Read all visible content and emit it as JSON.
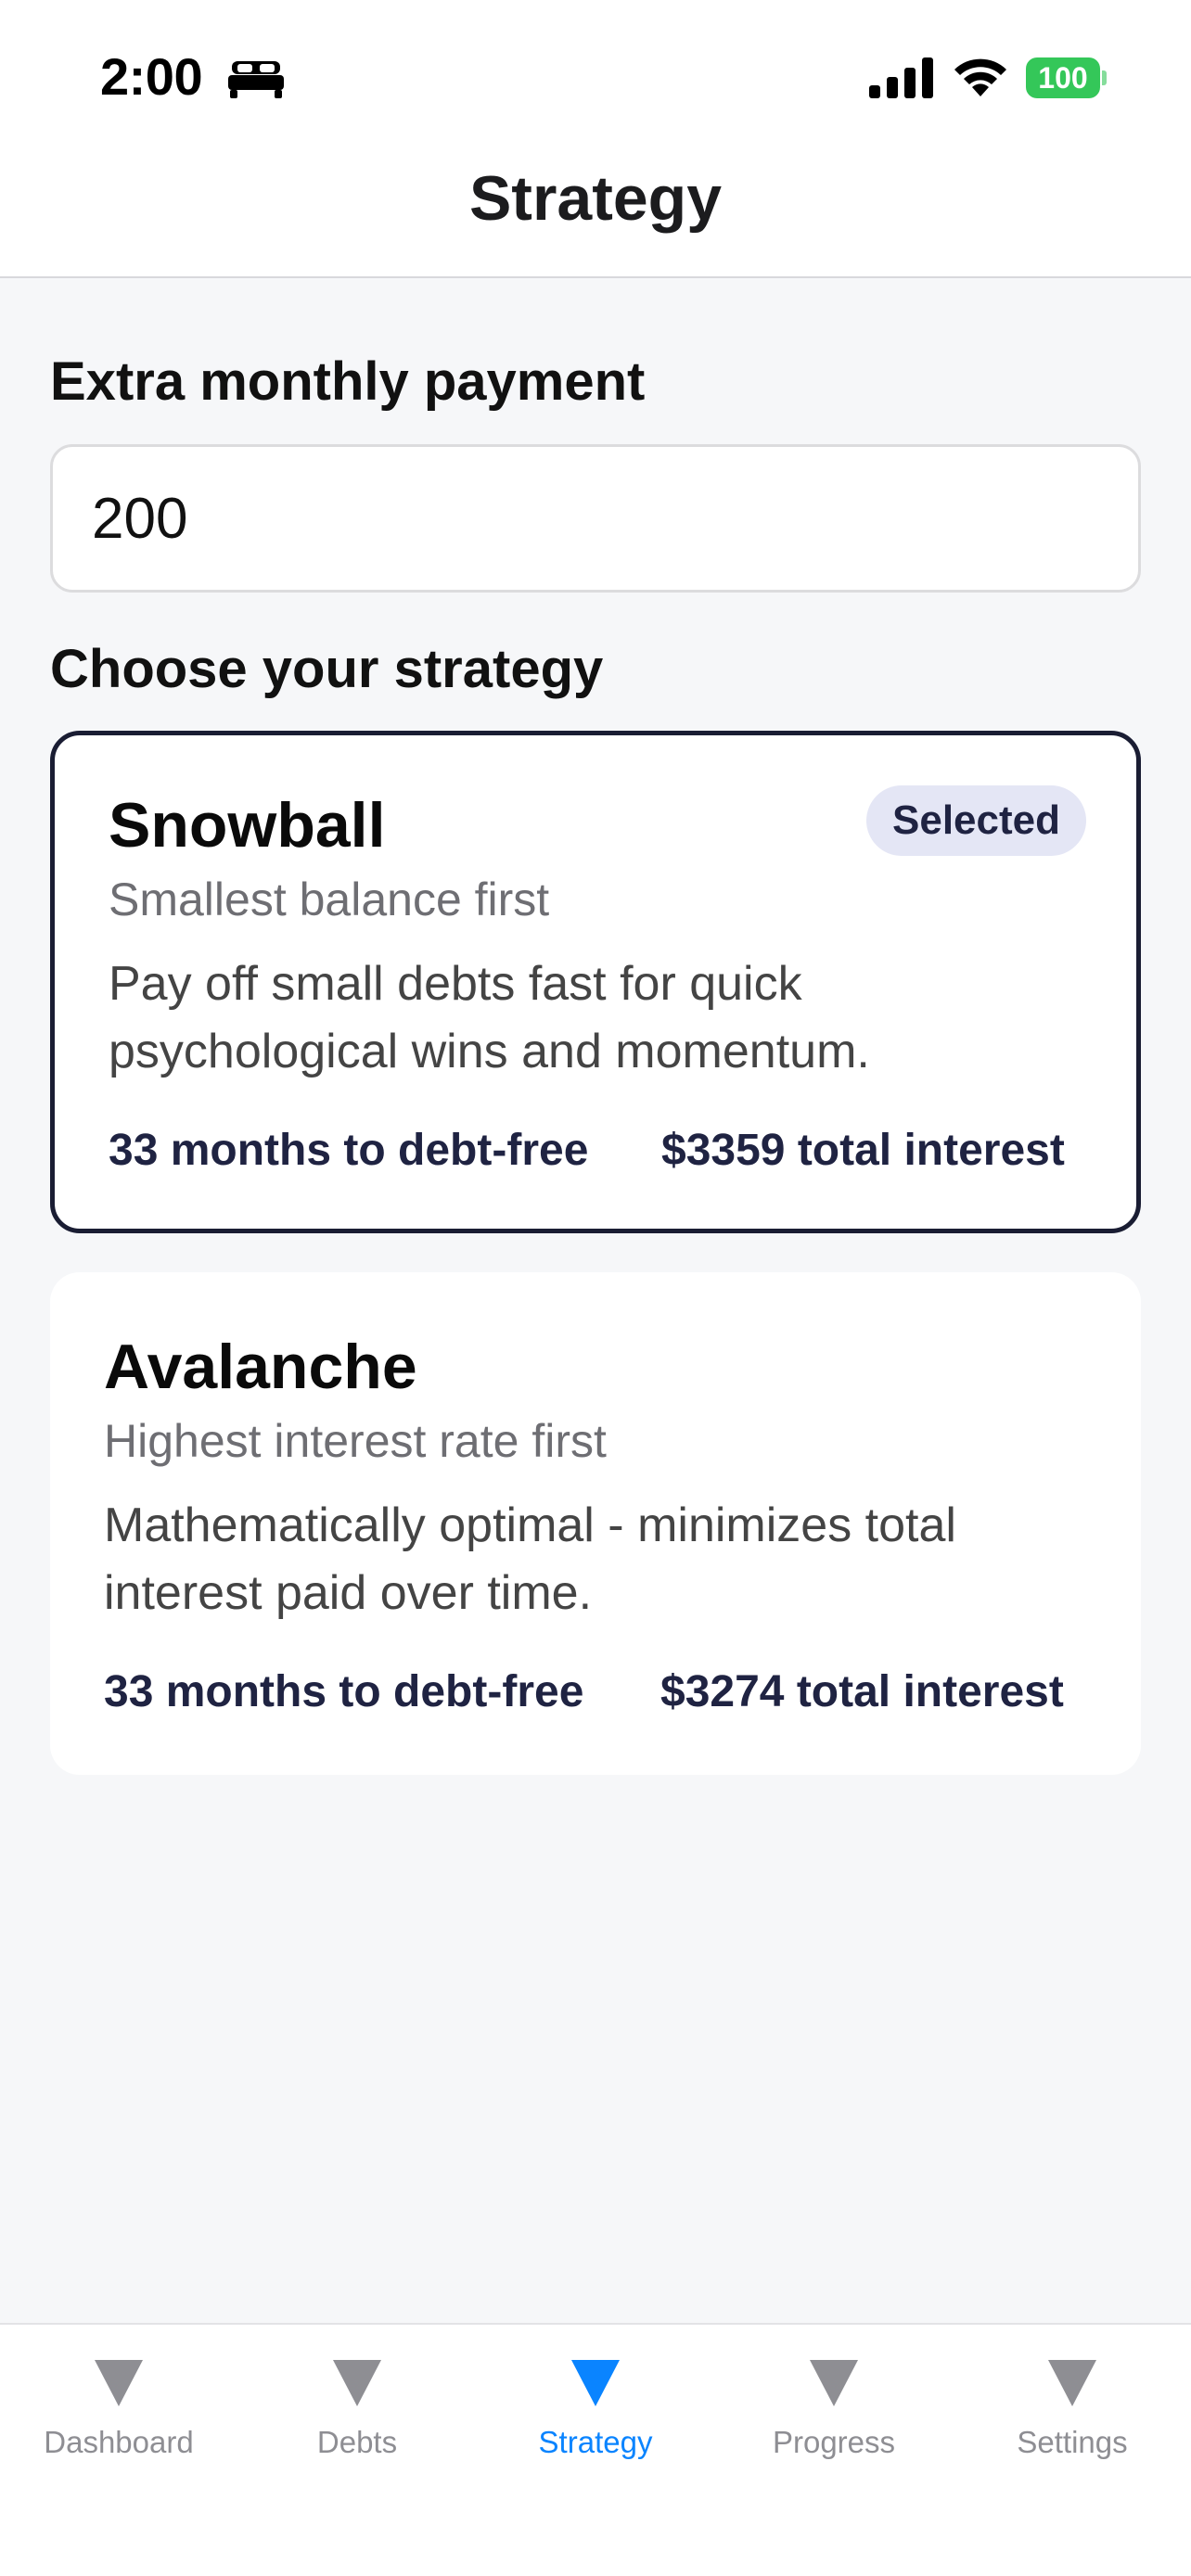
{
  "status_bar": {
    "time": "2:00",
    "battery": "100",
    "icons": [
      "bed-icon",
      "cellular-signal-icon",
      "wifi-icon",
      "battery-icon"
    ]
  },
  "header": {
    "title": "Strategy"
  },
  "extra_payment": {
    "label": "Extra monthly payment",
    "value": "200"
  },
  "strategy_section": {
    "label": "Choose your strategy"
  },
  "strategies": [
    {
      "title": "Snowball",
      "subtitle": "Smallest balance first",
      "description": "Pay off small debts fast for quick psychological wins and momentum.",
      "months": "33 months to debt-free",
      "interest": "$3359 total interest",
      "badge": "Selected",
      "selected": true
    },
    {
      "title": "Avalanche",
      "subtitle": "Highest interest rate first",
      "description": "Mathematically optimal - minimizes total interest paid over time.",
      "months": "33 months to debt-free",
      "interest": "$3274 total interest",
      "selected": false
    }
  ],
  "tab_bar": {
    "tabs": [
      {
        "label": "Dashboard",
        "active": false
      },
      {
        "label": "Debts",
        "active": false
      },
      {
        "label": "Strategy",
        "active": true
      },
      {
        "label": "Progress",
        "active": false
      },
      {
        "label": "Settings",
        "active": false
      }
    ]
  },
  "colors": {
    "accent": "#0a84ff",
    "selected_border": "#1a1d33",
    "badge_bg": "#e4e6f5",
    "battery": "#34c759",
    "background": "#f6f7f9"
  }
}
